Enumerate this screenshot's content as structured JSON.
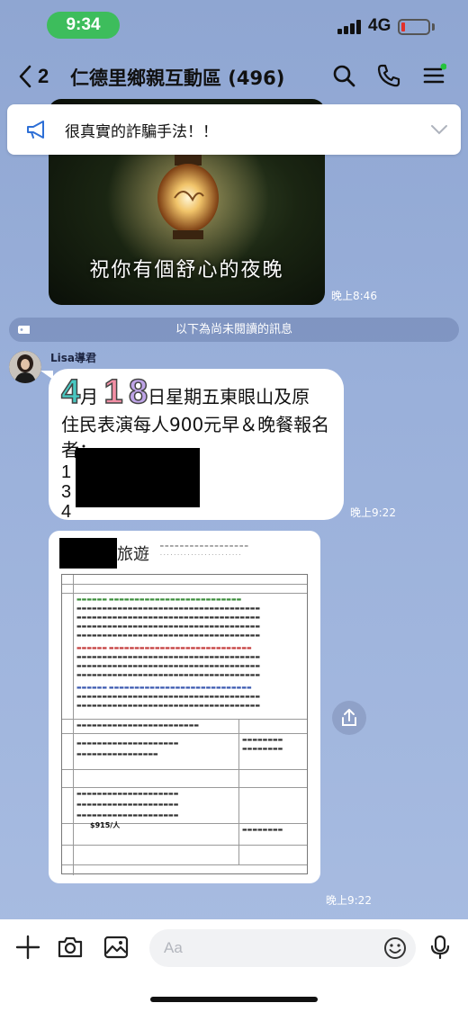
{
  "status_bar": {
    "time": "9:34",
    "network": "4G",
    "colors": {
      "time_pill": "#3dbd5c",
      "battery_low": "#e2302a"
    }
  },
  "header": {
    "back_count": "2",
    "title": "仁德里鄉親互動區 (496)",
    "icons": [
      "search-icon",
      "phone-icon",
      "menu-icon"
    ],
    "menu_dot_color": "#25c43c"
  },
  "announcement": {
    "text": "很真實的詐騙手法！！",
    "icons": [
      "megaphone-icon",
      "chevron-down-icon"
    ]
  },
  "messages": [
    {
      "type": "image",
      "caption": "祝你有個舒心的夜晚",
      "time": "晚上8:46"
    },
    {
      "type": "divider",
      "text": "以下為尚未閱讀的訊息"
    },
    {
      "type": "text",
      "sender": "Lisa導君",
      "month": "4",
      "month_suffix": "月",
      "day_1": "1",
      "day_2": "8",
      "line1_rest": "日星期五東眼山及原",
      "line2": "住民表演每人900元早＆晚餐報名",
      "line3": "者：",
      "list_numbers": [
        "1",
        "3",
        "4"
      ],
      "time": "晚上9:22"
    },
    {
      "type": "image-document",
      "doc_brand": "旅遊",
      "doc_price": "$915/人",
      "time": "晚上9:22"
    }
  ],
  "input_bar": {
    "placeholder": "Aa",
    "icons": [
      "plus-icon",
      "camera-icon",
      "image-icon",
      "emoji-icon",
      "mic-icon"
    ]
  }
}
